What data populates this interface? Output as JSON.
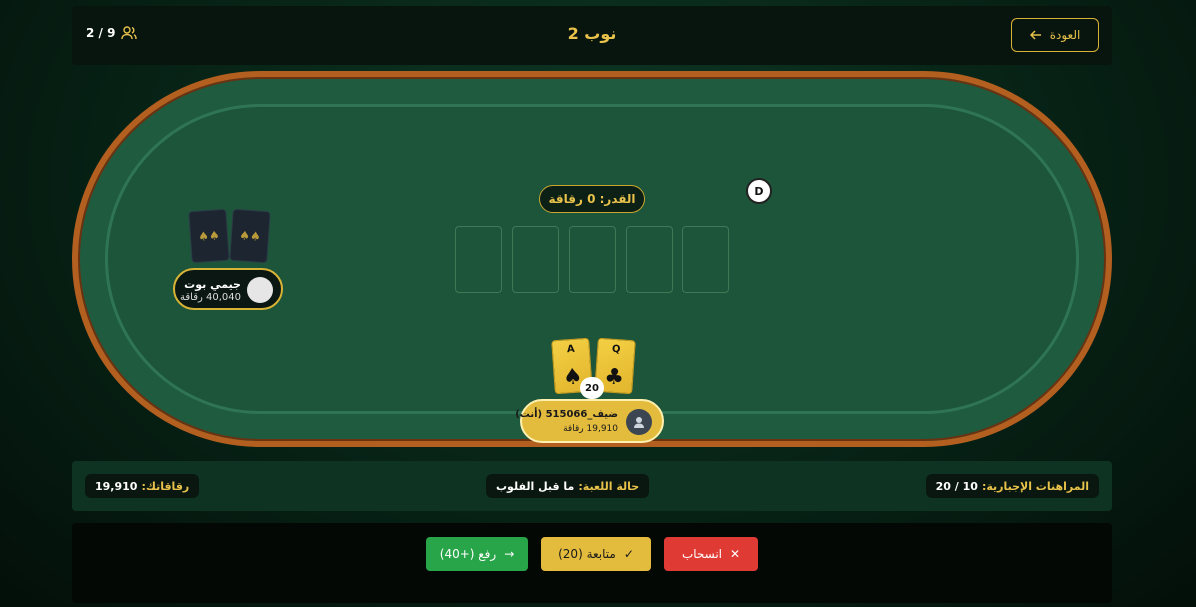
{
  "header": {
    "back_label": "العودة",
    "title": "نوب 2",
    "players_count": "2 / 9"
  },
  "table": {
    "pot_label": "القدر: 0 رقاقة",
    "dealer_label": "D"
  },
  "opponent": {
    "name": "جيمي بوت",
    "chips": "40,040 رقاقة",
    "card_glyph": "♠♠"
  },
  "hero": {
    "name": "ضيف_515066  (أنت)",
    "chips": "19,910 رقاقة",
    "bet": "20",
    "cards": [
      {
        "rank": "A",
        "suit": "♠"
      },
      {
        "rank": "Q",
        "suit": "♣"
      }
    ]
  },
  "info": {
    "blinds_label": "المراهنات الإجبارية:",
    "blinds_value": "10 / 20",
    "status_label": "حالة اللعبة:",
    "status_value": "ما قبل الفلوب",
    "chips_label": "رقاقاتك:",
    "chips_value": "19,910"
  },
  "actions": {
    "fold": "انسحاب",
    "call": "متابعة (20)",
    "raise": "رفع (+40)"
  },
  "colors": {
    "accent_gold": "#e8c24a",
    "fold_red": "#e03a34",
    "raise_green": "#28a548",
    "felt": "#1c5539",
    "rail": "#b35f1f"
  }
}
